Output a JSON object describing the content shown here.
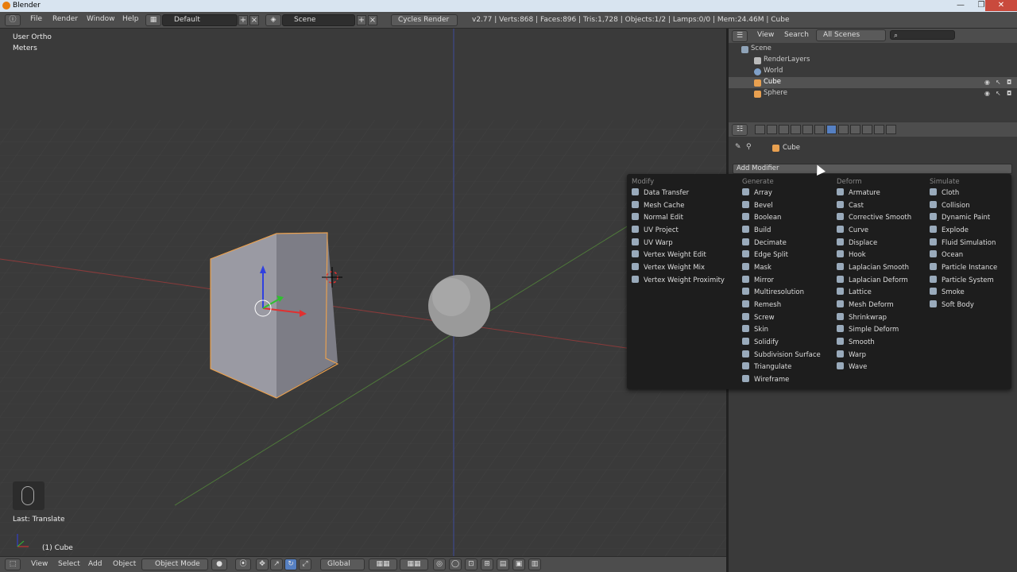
{
  "window": {
    "title": "Blender",
    "minimize": "—",
    "maximize": "❐",
    "close": "✕"
  },
  "info_header": {
    "menus": [
      "File",
      "Render",
      "Window",
      "Help"
    ],
    "screen_layout": "Default",
    "scene": "Scene",
    "render_engine": "Cycles Render",
    "stats": "v2.77 | Verts:868 | Faces:896 | Tris:1,728 | Objects:1/2 | Lamps:0/0 | Mem:24.46M | Cube"
  },
  "viewport": {
    "view_name": "User Ortho",
    "units": "Meters",
    "last_operator": "Last: Translate",
    "selected_object": "(1) Cube"
  },
  "viewport_footer": {
    "menus": [
      "View",
      "Select",
      "Add",
      "Object"
    ],
    "mode": "Object Mode",
    "orientation": "Global"
  },
  "outliner": {
    "menus": [
      "View",
      "Search"
    ],
    "filter": "All Scenes",
    "items": [
      {
        "label": "Scene",
        "icon_color": "#8fa3b8"
      },
      {
        "label": "RenderLayers",
        "icon_color": "#bbbbbb"
      },
      {
        "label": "World",
        "icon_color": "#7fa0c8"
      },
      {
        "label": "Cube",
        "icon_color": "#e8a050"
      },
      {
        "label": "Sphere",
        "icon_color": "#e8a050"
      }
    ]
  },
  "properties": {
    "context_object": "Cube",
    "add_modifier_label": "Add Modifier"
  },
  "modifier_menu": {
    "columns": [
      {
        "heading": "Modify",
        "items": [
          "Data Transfer",
          "Mesh Cache",
          "Normal Edit",
          "UV Project",
          "UV Warp",
          "Vertex Weight Edit",
          "Vertex Weight Mix",
          "Vertex Weight Proximity"
        ]
      },
      {
        "heading": "Generate",
        "items": [
          "Array",
          "Bevel",
          "Boolean",
          "Build",
          "Decimate",
          "Edge Split",
          "Mask",
          "Mirror",
          "Multiresolution",
          "Remesh",
          "Screw",
          "Skin",
          "Solidify",
          "Subdivision Surface",
          "Triangulate",
          "Wireframe"
        ]
      },
      {
        "heading": "Deform",
        "items": [
          "Armature",
          "Cast",
          "Corrective Smooth",
          "Curve",
          "Displace",
          "Hook",
          "Laplacian Smooth",
          "Laplacian Deform",
          "Lattice",
          "Mesh Deform",
          "Shrinkwrap",
          "Simple Deform",
          "Smooth",
          "Warp",
          "Wave"
        ]
      },
      {
        "heading": "Simulate",
        "items": [
          "Cloth",
          "Collision",
          "Dynamic Paint",
          "Explode",
          "Fluid Simulation",
          "Ocean",
          "Particle Instance",
          "Particle System",
          "Smoke",
          "Soft Body"
        ]
      }
    ]
  },
  "colors": {
    "accent": "#5680c2",
    "selection": "#e8a050",
    "background": "#393939",
    "menu": "#1d1d1d"
  }
}
